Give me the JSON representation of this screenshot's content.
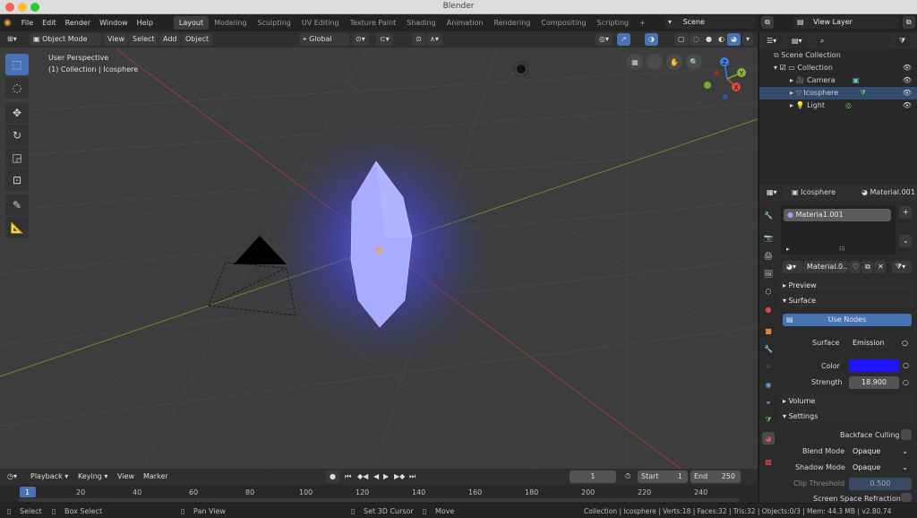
{
  "window": {
    "title": "Blender"
  },
  "menus": [
    "File",
    "Edit",
    "Render",
    "Window",
    "Help"
  ],
  "workspaces": [
    {
      "label": "Layout",
      "active": true
    },
    {
      "label": "Modeling"
    },
    {
      "label": "Sculpting"
    },
    {
      "label": "UV Editing"
    },
    {
      "label": "Texture Paint"
    },
    {
      "label": "Shading"
    },
    {
      "label": "Animation"
    },
    {
      "label": "Rendering"
    },
    {
      "label": "Compositing"
    },
    {
      "label": "Scripting"
    }
  ],
  "add_workspace": "+",
  "scene": "Scene",
  "view_layer": "View Layer",
  "viewport": {
    "mode": "Object Mode",
    "menu": [
      "View",
      "Select",
      "Add",
      "Object"
    ],
    "orientation": "Global",
    "perspective": "User Perspective",
    "collection_info": "(1) Collection | Icosphere",
    "gizmo_axes": {
      "x": "X",
      "y": "Y",
      "z": "Z"
    }
  },
  "outliner": {
    "root": "Scene Collection",
    "collection": "Collection",
    "items": [
      "Camera",
      "Icosphere",
      "Light"
    ]
  },
  "properties": {
    "object": "Icosphere",
    "material": "Material.001",
    "slot": "Materia1.001",
    "mat_field": "Material.0...",
    "sections": {
      "preview": "Preview",
      "surface": "Surface",
      "volume": "Volume",
      "settings": "Settings"
    },
    "use_nodes": "Use Nodes",
    "surface_label": "Surface",
    "surface_value": "Emission",
    "color_label": "Color",
    "color_value": "#1e14ff",
    "strength_label": "Strength",
    "strength_value": "18.900",
    "backface": "Backface Culling",
    "blend_label": "Blend Mode",
    "blend_value": "Opaque",
    "shadow_label": "Shadow Mode",
    "shadow_value": "Opaque",
    "clip_label": "Clip Threshold",
    "clip_value": "0.500",
    "ssr": "Screen Space Refraction"
  },
  "timeline": {
    "menu": [
      "Playback",
      "Keying",
      "View",
      "Marker"
    ],
    "current": "1",
    "start_label": "Start",
    "start": "1",
    "end_label": "End",
    "end": "250",
    "ticks": [
      "1",
      "20",
      "40",
      "60",
      "80",
      "100",
      "120",
      "140",
      "160",
      "180",
      "200",
      "220",
      "240"
    ]
  },
  "status": {
    "select": "Select",
    "box_select": "Box Select",
    "pan_view": "Pan View",
    "cursor": "Set 3D Cursor",
    "move": "Move",
    "stats": "Collection | Icosphere | Verts:18 | Faces:32 | Tris:32 | Objects:0/3 | Mem: 44.3 MB | v2.80.74"
  }
}
